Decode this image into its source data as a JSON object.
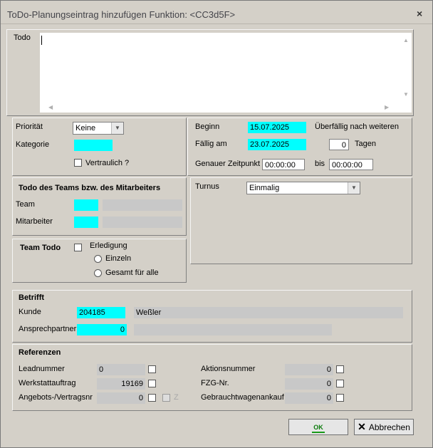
{
  "window": {
    "title": "ToDo-Planungseintrag hinzufügen   Funktion: <CC3d5F>",
    "close_glyph": "×"
  },
  "todo": {
    "label": "Todo",
    "value": ""
  },
  "left_top": {
    "prioritaet_label": "Priorität",
    "prioritaet_value": "Keine",
    "kategorie_label": "Kategorie",
    "kategorie_value": "",
    "vertraulich_label": "Vertraulich ?"
  },
  "dates": {
    "beginn_label": "Beginn",
    "beginn_value": "15.07.2025",
    "ueberfaellig_label": "Überfällig nach weiteren",
    "faellig_label": "Fällig am",
    "faellig_value": "23.07.2025",
    "tage_value": "0",
    "tage_label": "Tagen",
    "zeitpunkt_label": "Genauer Zeitpunkt",
    "zeit_von": "00:00:00",
    "bis_label": "bis",
    "zeit_bis": "00:00:00"
  },
  "team": {
    "heading": "Todo des Teams bzw. des  Mitarbeiters",
    "team_label": "Team",
    "mitarbeiter_label": "Mitarbeiter"
  },
  "turnus": {
    "label": "Turnus",
    "value": "Einmalig"
  },
  "team_todo": {
    "label": "Team Todo",
    "erledigung_label": "Erledigung",
    "einzeln_label": "Einzeln",
    "gesamt_label": "Gesamt für alle"
  },
  "betrifft": {
    "heading": "Betrifft",
    "kunde_label": "Kunde",
    "kunde_nr": "204185",
    "kunde_name": "Weßler",
    "ansprech_label": "Ansprechpartner",
    "ansprech_value": "0"
  },
  "referenzen": {
    "heading": "Referenzen",
    "lead_label": "Leadnummer",
    "lead_value": "0",
    "werkstatt_label": "Werkstattauftrag",
    "werkstatt_value": "19169",
    "angebot_label": "Angebots-/Vertragsnr",
    "angebot_value": "0",
    "z_label": "Z",
    "aktion_label": "Aktionsnummer",
    "aktion_value": "0",
    "fzg_label": "FZG-Nr.",
    "fzg_value": "0",
    "gebraucht_label": "Gebrauchtwagenankauf",
    "gebraucht_value": "0"
  },
  "buttons": {
    "ok_label": "OK",
    "abbrechen_label": "Abbrechen"
  },
  "colors": {
    "field_highlight": "#00ffff",
    "dialog_bg": "#d4d0c8"
  }
}
